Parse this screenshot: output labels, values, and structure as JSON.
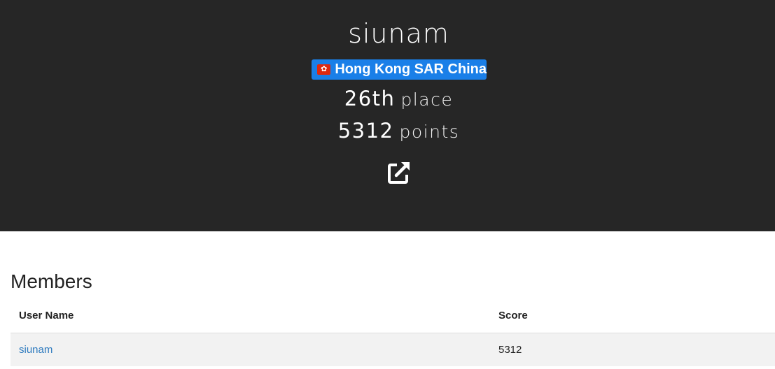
{
  "team": {
    "name": "siunam",
    "country": {
      "label": "Hong Kong SAR China",
      "flag_icon": "hong-kong-flag-icon",
      "flag_glyph": "✿",
      "badge_color": "#1a7fe8"
    },
    "place": {
      "value": "26th",
      "unit": "place"
    },
    "points": {
      "value": "5312",
      "unit": "points"
    },
    "external_link_icon": "external-link-icon"
  },
  "members": {
    "title": "Members",
    "columns": [
      "User Name",
      "Score"
    ],
    "rows": [
      {
        "user": "siunam",
        "score": "5312"
      }
    ]
  },
  "colors": {
    "header_background": "#262626",
    "link": "#2f7bbf",
    "row_background": "#f2f2f2"
  }
}
